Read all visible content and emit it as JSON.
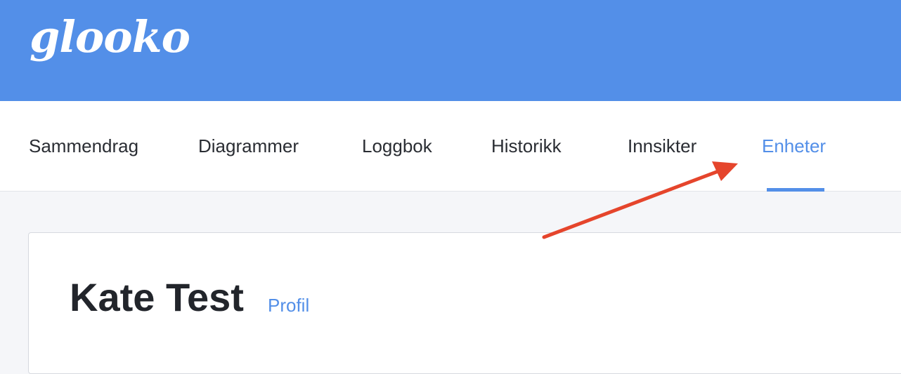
{
  "header": {
    "logo_text": "glooko",
    "background_color": "#538fe8"
  },
  "nav": {
    "tabs": [
      {
        "label": "Sammendrag",
        "active": false
      },
      {
        "label": "Diagrammer",
        "active": false
      },
      {
        "label": "Loggbok",
        "active": false
      },
      {
        "label": "Historikk",
        "active": false
      },
      {
        "label": "Innsikter",
        "active": false
      },
      {
        "label": "Enheter",
        "active": true
      }
    ],
    "accent_color": "#538fe8"
  },
  "patient": {
    "name": "Kate Test",
    "profile_link": "Profil"
  },
  "annotation": {
    "arrow_color": "#e5452c",
    "points_to": "Enheter"
  }
}
